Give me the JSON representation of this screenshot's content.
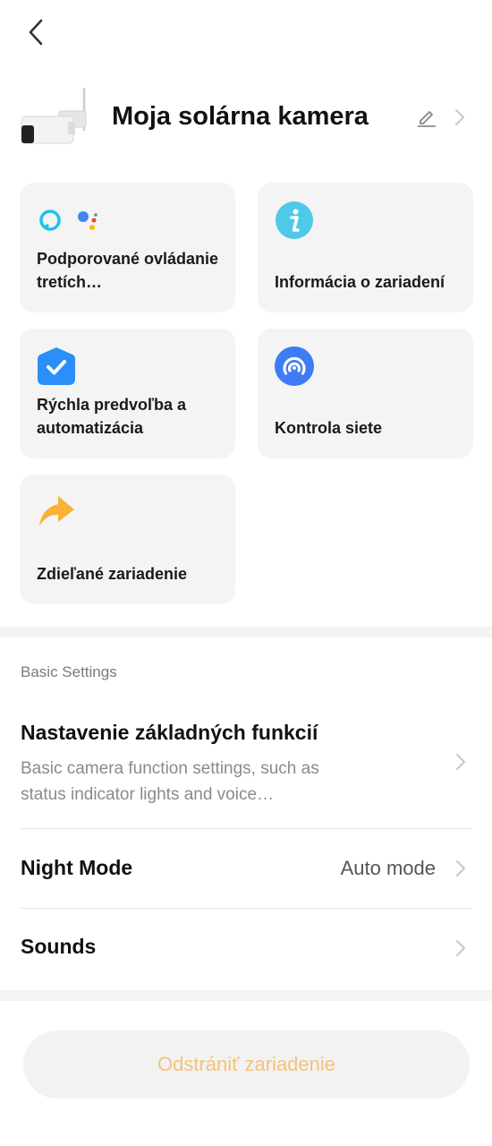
{
  "nav": {
    "back_icon": "chevron-left-icon"
  },
  "device": {
    "name": "Moja solárna kamera",
    "thumbnail": "solar-camera-image",
    "edit_icon": "pencil-icon",
    "chevron_icon": "chevron-right-icon"
  },
  "tiles": [
    {
      "label": "Podporované ovládanie tretích…",
      "icons": [
        "alexa-icon",
        "google-assistant-icon"
      ]
    },
    {
      "label": "Informácia o zariadení",
      "icons": [
        "info-icon"
      ],
      "color": "#4fc9e8"
    },
    {
      "label": "Rýchla predvoľba a automatizácia",
      "icons": [
        "automation-check-icon"
      ],
      "color": "#2c8ef8"
    },
    {
      "label": "Kontrola siete",
      "icons": [
        "network-check-icon"
      ],
      "color": "#3d7cf5"
    },
    {
      "label": "Zdieľané zariadenie",
      "icons": [
        "share-arrow-icon"
      ],
      "color": "#f9b233"
    }
  ],
  "settings": {
    "section_title": "Basic Settings",
    "rows": [
      {
        "title": "Nastavenie základných funkcií",
        "subtitle": "Basic camera function settings, such as status indicator lights and voice…",
        "value": ""
      },
      {
        "title": "Night Mode",
        "subtitle": "",
        "value": "Auto mode"
      },
      {
        "title": "Sounds",
        "subtitle": "",
        "value": ""
      }
    ]
  },
  "delete_button": {
    "label": "Odstrániť zariadenie",
    "color": "#f5c27a"
  },
  "colors": {
    "tile_bg": "#f4f4f4",
    "separator": "#f4f4f4"
  }
}
